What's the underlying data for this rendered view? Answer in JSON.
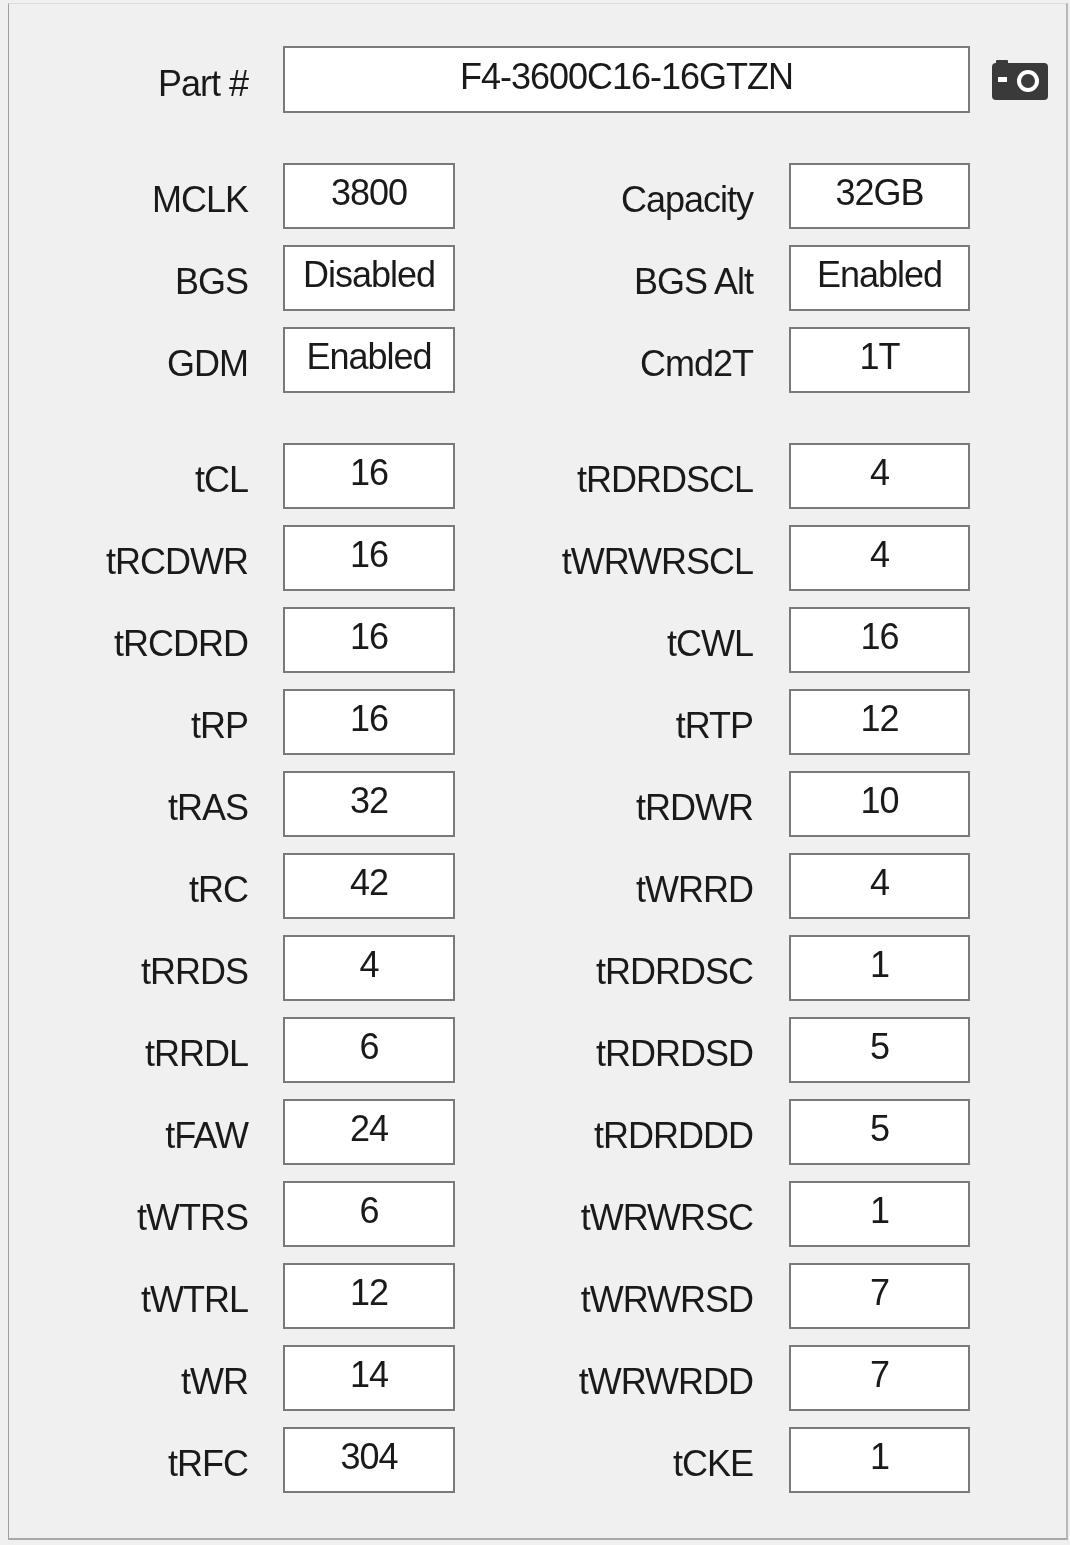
{
  "part_number": {
    "label": "Part #",
    "value": "F4-3600C16-16GTZN"
  },
  "general": [
    {
      "left": {
        "label": "MCLK",
        "value": "3800"
      },
      "right": {
        "label": "Capacity",
        "value": "32GB"
      }
    },
    {
      "left": {
        "label": "BGS",
        "value": "Disabled"
      },
      "right": {
        "label": "BGS Alt",
        "value": "Enabled"
      }
    },
    {
      "left": {
        "label": "GDM",
        "value": "Enabled"
      },
      "right": {
        "label": "Cmd2T",
        "value": "1T"
      }
    }
  ],
  "timings": [
    {
      "left": {
        "label": "tCL",
        "value": "16"
      },
      "right": {
        "label": "tRDRDSCL",
        "value": "4"
      }
    },
    {
      "left": {
        "label": "tRCDWR",
        "value": "16"
      },
      "right": {
        "label": "tWRWRSCL",
        "value": "4"
      }
    },
    {
      "left": {
        "label": "tRCDRD",
        "value": "16"
      },
      "right": {
        "label": "tCWL",
        "value": "16"
      }
    },
    {
      "left": {
        "label": "tRP",
        "value": "16"
      },
      "right": {
        "label": "tRTP",
        "value": "12"
      }
    },
    {
      "left": {
        "label": "tRAS",
        "value": "32"
      },
      "right": {
        "label": "tRDWR",
        "value": "10"
      }
    },
    {
      "left": {
        "label": "tRC",
        "value": "42"
      },
      "right": {
        "label": "tWRRD",
        "value": "4"
      }
    },
    {
      "left": {
        "label": "tRRDS",
        "value": "4"
      },
      "right": {
        "label": "tRDRDSC",
        "value": "1"
      }
    },
    {
      "left": {
        "label": "tRRDL",
        "value": "6"
      },
      "right": {
        "label": "tRDRDSD",
        "value": "5"
      }
    },
    {
      "left": {
        "label": "tFAW",
        "value": "24"
      },
      "right": {
        "label": "tRDRDDD",
        "value": "5"
      }
    },
    {
      "left": {
        "label": "tWTRS",
        "value": "6"
      },
      "right": {
        "label": "tWRWRSC",
        "value": "1"
      }
    },
    {
      "left": {
        "label": "tWTRL",
        "value": "12"
      },
      "right": {
        "label": "tWRWRSD",
        "value": "7"
      }
    },
    {
      "left": {
        "label": "tWR",
        "value": "14"
      },
      "right": {
        "label": "tWRWRDD",
        "value": "7"
      }
    },
    {
      "left": {
        "label": "tRFC",
        "value": "304"
      },
      "right": {
        "label": "tCKE",
        "value": "1"
      }
    }
  ]
}
